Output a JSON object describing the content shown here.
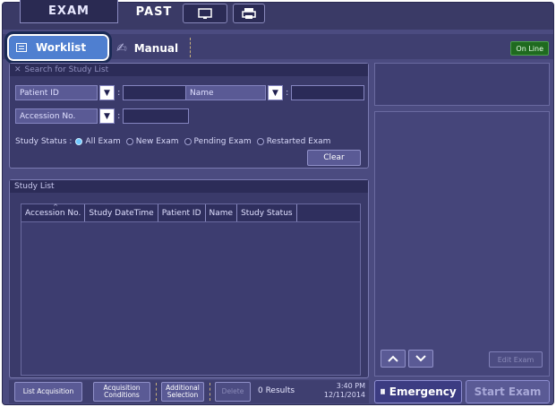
{
  "top_tabs": {
    "exam": "EXAM",
    "past": "PAST"
  },
  "toolbar_icons": [
    "monitor-icon",
    "printer-icon"
  ],
  "tabs": {
    "worklist": "Worklist",
    "manual": "Manual",
    "online": "On Line"
  },
  "search": {
    "header": "Search for Study List",
    "patient_id_label": "Patient ID",
    "name_label": "Name",
    "accession_label": "Accession No.",
    "patient_id_value": "",
    "name_value": "",
    "accession_value": "",
    "status_label": "Study Status :",
    "status_options": [
      "All Exam",
      "New Exam",
      "Pending Exam",
      "Restarted Exam"
    ],
    "status_selected": "All Exam",
    "clear_label": "Clear"
  },
  "study_list": {
    "header": "Study List",
    "columns": [
      "Accession No.",
      "Study DateTime",
      "Patient ID",
      "Name",
      "Study Status"
    ],
    "rows": []
  },
  "bottom": {
    "list_acquisition": "List Acquisition",
    "acq_conditions": "Acquisition Conditions",
    "additional_selection": "Additional Selection",
    "delete": "Delete",
    "results": "0 Results",
    "time": "3:40 PM",
    "date": "12/11/2014"
  },
  "right": {
    "edit_exam": "Edit Exam",
    "emergency": "Emergency",
    "start_exam": "Start Exam"
  },
  "colors": {
    "background": "#4b4b80",
    "accent_tab": "#4f7fd0",
    "online": "#1f6a1f",
    "radio_selected": "#6fc8ff"
  }
}
